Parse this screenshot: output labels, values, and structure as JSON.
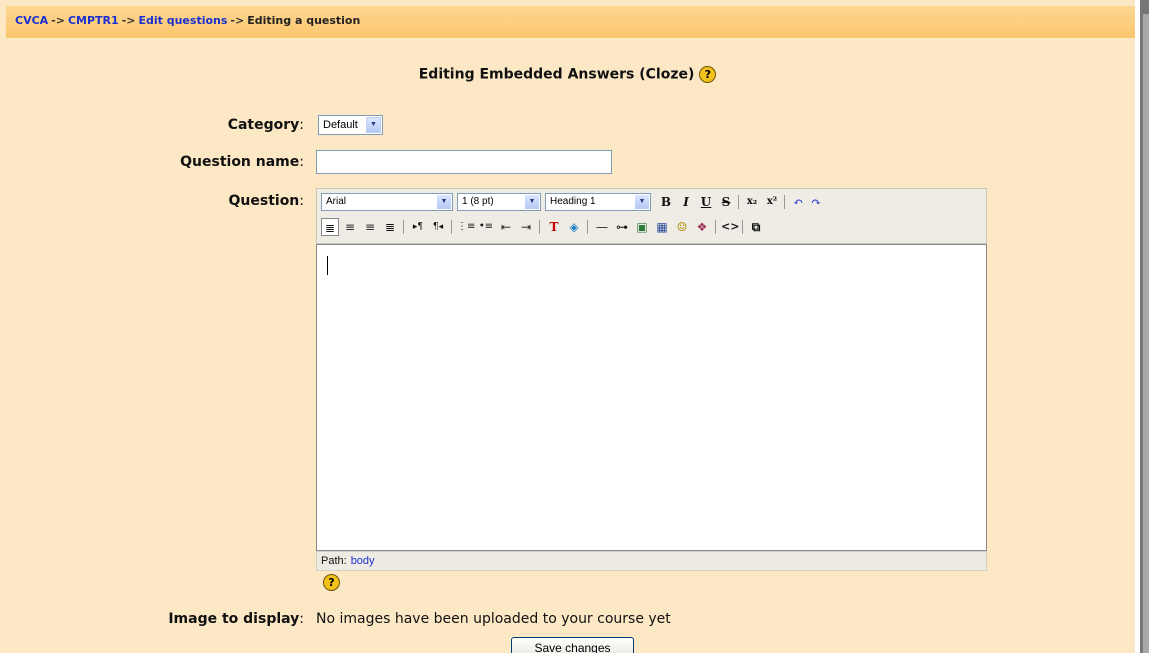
{
  "breadcrumb": {
    "items": [
      "CVCA",
      "CMPTR1",
      "Edit questions"
    ],
    "current": "Editing a question",
    "separator": "->"
  },
  "heading": {
    "title": "Editing Embedded Answers (Cloze)",
    "help_glyph": "?"
  },
  "form": {
    "category": {
      "label": "Category",
      "value": "Default"
    },
    "question_name": {
      "label": "Question name",
      "value": ""
    },
    "question": {
      "label": "Question"
    },
    "image": {
      "label": "Image to display",
      "value": "No images have been uploaded to your course yet"
    },
    "colon": ":"
  },
  "editor": {
    "font_select": "Arial",
    "size_select": "1 (8 pt)",
    "format_select": "Heading 1",
    "path_label": "Path:",
    "path_value": "body",
    "buttons_row1": [
      {
        "name": "bold-button",
        "glyph": "B"
      },
      {
        "name": "italic-button",
        "glyph": "I"
      },
      {
        "name": "underline-button",
        "glyph": "U"
      },
      {
        "name": "strikethrough-button",
        "glyph": "S"
      },
      {
        "name": "subscript-button",
        "glyph": "x₂"
      },
      {
        "name": "superscript-button",
        "glyph": "x²"
      },
      {
        "name": "undo-button",
        "glyph": "↶"
      },
      {
        "name": "redo-button",
        "glyph": "↷"
      }
    ],
    "buttons_row2": [
      {
        "name": "align-left-button",
        "glyph": "≣"
      },
      {
        "name": "align-center-button",
        "glyph": "≡"
      },
      {
        "name": "align-right-button",
        "glyph": "≡"
      },
      {
        "name": "justify-button",
        "glyph": "≣"
      },
      {
        "name": "ltr-button",
        "glyph": "▸¶"
      },
      {
        "name": "rtl-button",
        "glyph": "¶◂"
      },
      {
        "name": "ordered-list-button",
        "glyph": "⋮≡"
      },
      {
        "name": "unordered-list-button",
        "glyph": "•≡"
      },
      {
        "name": "outdent-button",
        "glyph": "⇤"
      },
      {
        "name": "indent-button",
        "glyph": "⇥"
      },
      {
        "name": "text-color-button",
        "glyph": "T"
      },
      {
        "name": "bg-color-button",
        "glyph": "◈"
      },
      {
        "name": "horizontal-rule-button",
        "glyph": "—"
      },
      {
        "name": "link-button",
        "glyph": "⊶"
      },
      {
        "name": "image-button",
        "glyph": "▣"
      },
      {
        "name": "table-button",
        "glyph": "▦"
      },
      {
        "name": "smiley-button",
        "glyph": "☺"
      },
      {
        "name": "special-char-button",
        "glyph": "❖"
      },
      {
        "name": "html-source-button",
        "glyph": "<>"
      },
      {
        "name": "fullscreen-button",
        "glyph": "⧉"
      }
    ]
  },
  "actions": {
    "save_label": "Save changes"
  }
}
